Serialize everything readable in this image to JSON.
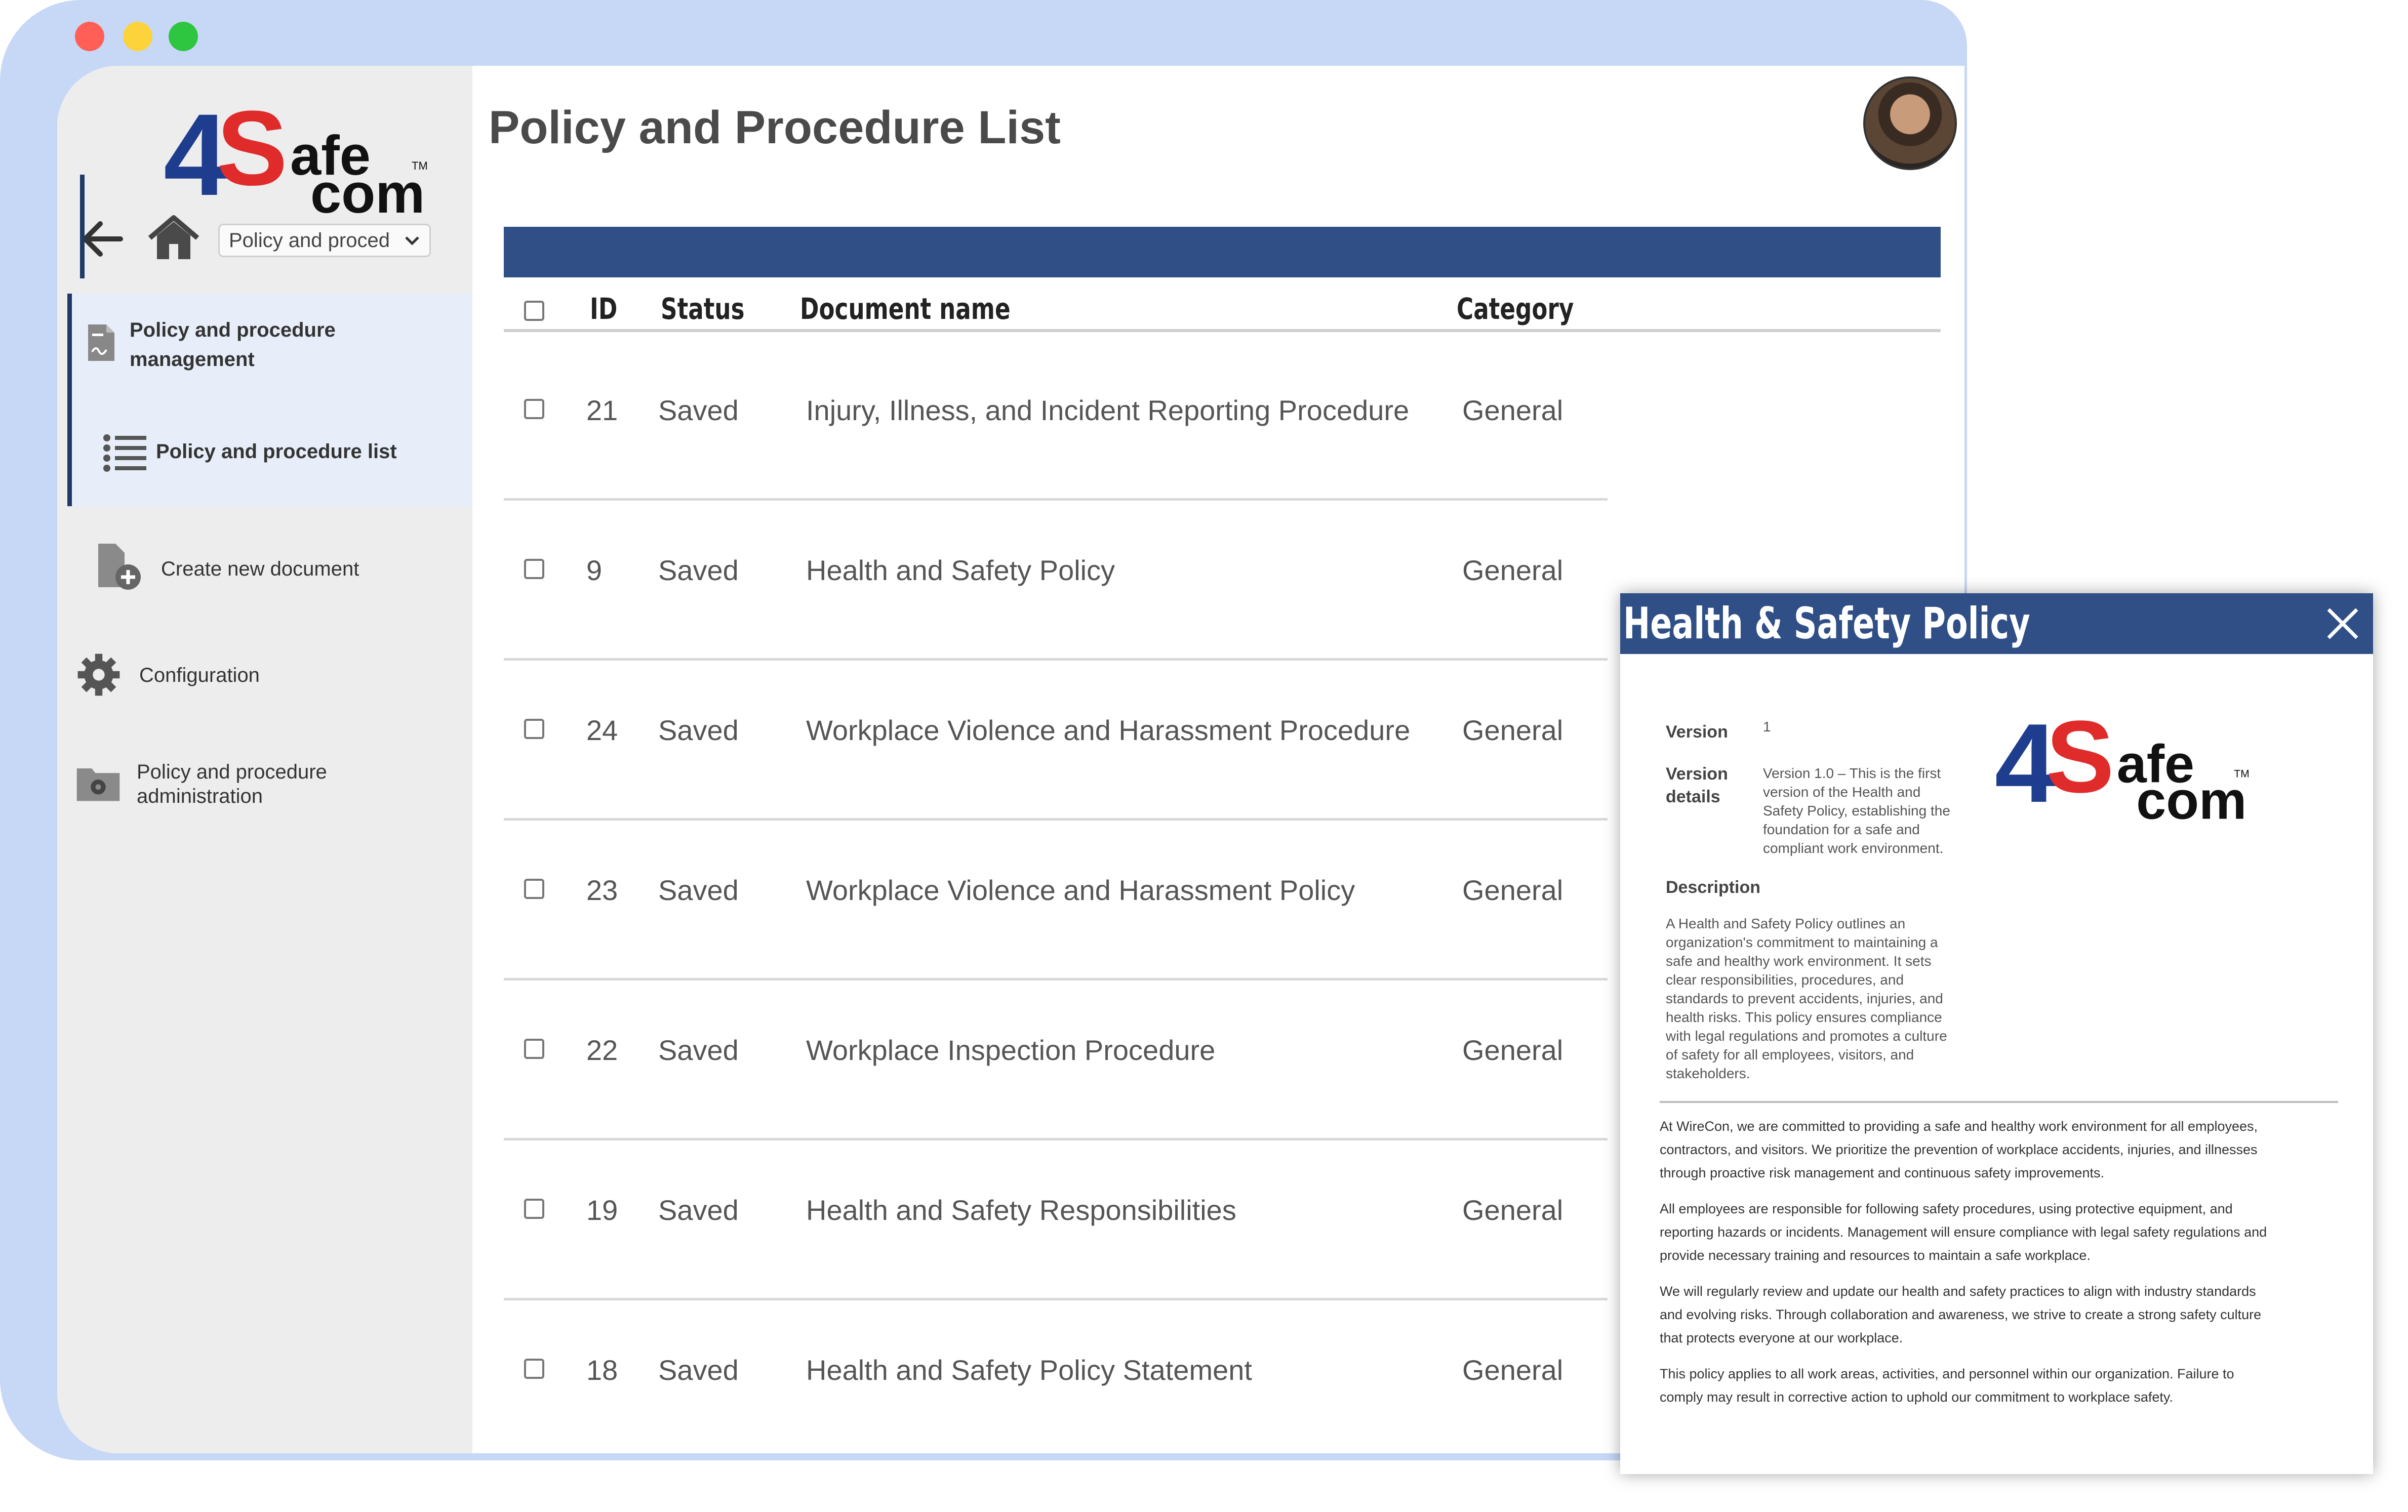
{
  "window": {
    "title": "Policy and Procedure List",
    "logo_text": {
      "num": "4",
      "s": "S",
      "afe": "afe",
      "com": "com",
      "tm": "TM"
    }
  },
  "nav": {
    "dropdown_value": "Policy and proced"
  },
  "sidebar": {
    "items": [
      {
        "label_line1": "Policy and procedure",
        "label_line2": "management",
        "icon": "document-signature-icon",
        "active": true
      },
      {
        "label": "Policy and procedure list",
        "icon": "list-icon",
        "active": true
      },
      {
        "label": "Create new document",
        "icon": "add-document-icon"
      },
      {
        "label": "Configuration",
        "icon": "gear-icon"
      },
      {
        "label_line1": "Policy and procedure",
        "label_line2": "administration",
        "icon": "folder-settings-icon"
      }
    ]
  },
  "table": {
    "columns": [
      "ID",
      "Status",
      "Document name",
      "Category"
    ],
    "rows": [
      {
        "id": "21",
        "status": "Saved",
        "name": "Injury, Illness, and Incident Reporting Procedure",
        "category": "General"
      },
      {
        "id": "9",
        "status": "Saved",
        "name": "Health and Safety Policy",
        "category": "General"
      },
      {
        "id": "24",
        "status": "Saved",
        "name": "Workplace Violence and Harassment Procedure",
        "category": "General"
      },
      {
        "id": "23",
        "status": "Saved",
        "name": "Workplace Violence and Harassment Policy",
        "category": "General"
      },
      {
        "id": "22",
        "status": "Saved",
        "name": "Workplace Inspection Procedure",
        "category": "General"
      },
      {
        "id": "19",
        "status": "Saved",
        "name": "Health and Safety Responsibilities",
        "category": "General"
      },
      {
        "id": "18",
        "status": "Saved",
        "name": "Health and Safety Policy Statement",
        "category": "General"
      }
    ]
  },
  "popup": {
    "title": "Health & Safety Policy",
    "version_label": "Version",
    "version_value": "1",
    "version_details_label_1": "Version",
    "version_details_label_2": "details",
    "version_details_lines": [
      "Version 1.0 – This is the first",
      "version of the Health and",
      "Safety Policy, establishing the",
      "foundation for a safe and",
      "compliant work environment."
    ],
    "description_label": "Description",
    "description_lines": [
      "A Health and Safety Policy outlines an",
      "organization's commitment to maintaining a",
      "safe and healthy work environment. It sets",
      "clear responsibilities, procedures, and",
      "standards to prevent accidents, injuries, and",
      "health risks. This policy ensures compliance",
      "with legal regulations and promotes a culture",
      "of safety for all employees, visitors, and",
      "stakeholders."
    ],
    "body_paragraphs": [
      [
        "At WireCon, we are committed to providing a safe and healthy work environment for all employees,",
        "contractors, and visitors. We prioritize the prevention of workplace accidents, injuries, and illnesses",
        "through proactive risk management and continuous safety improvements."
      ],
      [
        "All employees are responsible for following safety procedures, using protective equipment, and",
        "reporting hazards or incidents. Management will ensure compliance with legal safety regulations and",
        "provide necessary training and resources to maintain a safe workplace."
      ],
      [
        "We will regularly review and update our health and safety practices to align with industry standards",
        "and evolving risks. Through collaboration and awareness, we strive to create a strong safety culture",
        "that protects everyone at our workplace."
      ],
      [
        "This policy applies to all work areas, activities, and personnel within our organization. Failure to",
        "comply may result in corrective action to uphold our commitment to workplace safety."
      ]
    ]
  },
  "colors": {
    "brand_blue": "#1e3d8f",
    "brand_red": "#e02b2b",
    "header_band": "#2f4f86",
    "frame": "#c6d8f6",
    "sidebar_bg": "#ededed",
    "sidebar_active": "#e7eef9"
  }
}
